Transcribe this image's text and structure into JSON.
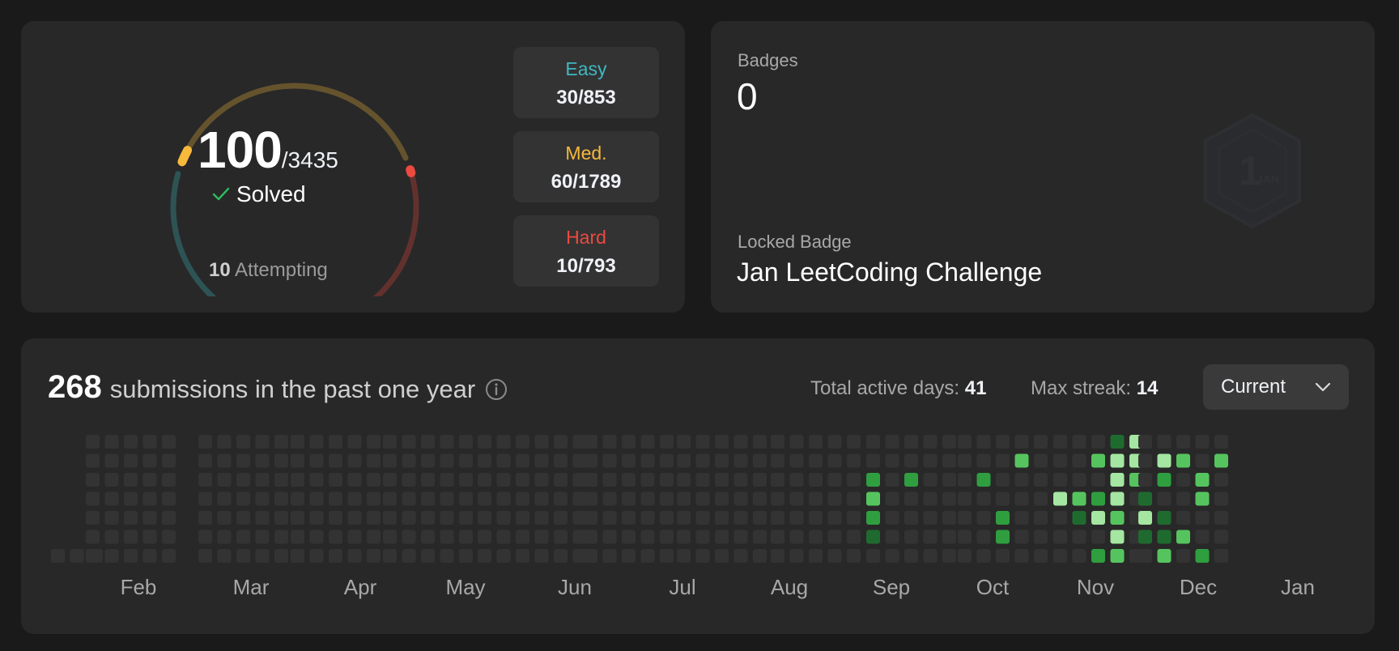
{
  "solved": {
    "count": "100",
    "total": "/3435",
    "label": "Solved",
    "attempting_count": "10",
    "attempting_label": "Attempting",
    "difficulties": [
      {
        "label": "Easy",
        "value": "30/853",
        "color": "#3fb8c1"
      },
      {
        "label": "Med.",
        "value": "60/1789",
        "color": "#f6b93b"
      },
      {
        "label": "Hard",
        "value": "10/793",
        "color": "#ec4a3f"
      }
    ],
    "ring_colors": {
      "easy": "#3fb8c1",
      "medium": "#f6b93b",
      "hard": "#ec4a3f"
    }
  },
  "badges": {
    "title": "Badges",
    "count": "0",
    "locked_title": "Locked Badge",
    "locked_name": "Jan LeetCoding Challenge",
    "badge_icon": "1-jan-hexagon-badge-icon",
    "badge_digit": "1",
    "badge_month": "JAN"
  },
  "submissions": {
    "count": "268",
    "text": "submissions in the past one year",
    "active_days_label": "Total active days:",
    "active_days": "41",
    "max_streak_label": "Max streak:",
    "max_streak": "14",
    "dropdown_value": "Current",
    "months": [
      "Feb",
      "Mar",
      "Apr",
      "May",
      "Jun",
      "Jul",
      "Aug",
      "Sep",
      "Oct",
      "Nov",
      "Dec",
      "Jan"
    ],
    "heat_colors": [
      "#333333",
      "#1f6b2f",
      "#2f9e3f",
      "#56c45e",
      "#a4e6a2"
    ]
  }
}
